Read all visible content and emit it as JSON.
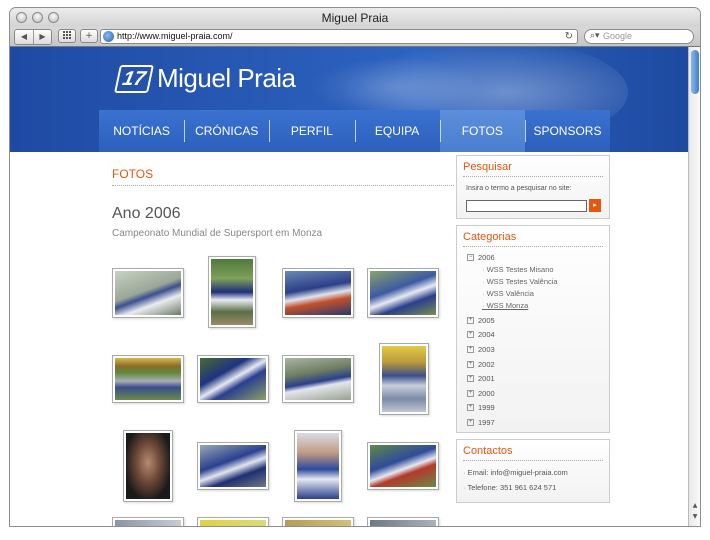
{
  "browser": {
    "window_title": "Miguel Praia",
    "url": "http://www.miguel-praia.com/",
    "search_placeholder": "Google",
    "back_glyph": "◀",
    "forward_glyph": "▶",
    "add_glyph": "+",
    "reload_glyph": "↻",
    "search_glyph": "⌕▾"
  },
  "site": {
    "logo_number": "17",
    "logo_name": "Miguel Praia"
  },
  "nav": {
    "items": [
      "NOTÍCIAS",
      "CRÓNICAS",
      "PERFIL",
      "EQUIPA",
      "FOTOS",
      "SPONSORS"
    ],
    "active": "FOTOS"
  },
  "content": {
    "section_title": "FOTOS",
    "year_title": "Ano 2006",
    "subtitle": "Campeonato Mundial de Supersport em Monza"
  },
  "sidebar": {
    "search": {
      "title": "Pesquisar",
      "label": "Insira o termo a pesquisar no site:",
      "button_glyph": "▸"
    },
    "categories": {
      "title": "Categorias",
      "expanded_year": "2006",
      "expanded_sign": "−",
      "collapsed_sign": "+",
      "subitems": [
        "WSS Testes Misano",
        "WSS Testes Valência",
        "WSS Valência",
        "WSS Monza"
      ],
      "current_subitem": "WSS Monza",
      "other_years": [
        "2005",
        "2004",
        "2003",
        "2002",
        "2001",
        "2000",
        "1999",
        "1997"
      ]
    },
    "contacts": {
      "title": "Contactos",
      "email": "Email: info@miguel-praia.com",
      "phone": "Telefone: 351 961 624 571"
    }
  },
  "colors": {
    "accent": "#e4570f",
    "header_blue": "#2d5fbc",
    "nav_active": "#4a7fcf"
  }
}
